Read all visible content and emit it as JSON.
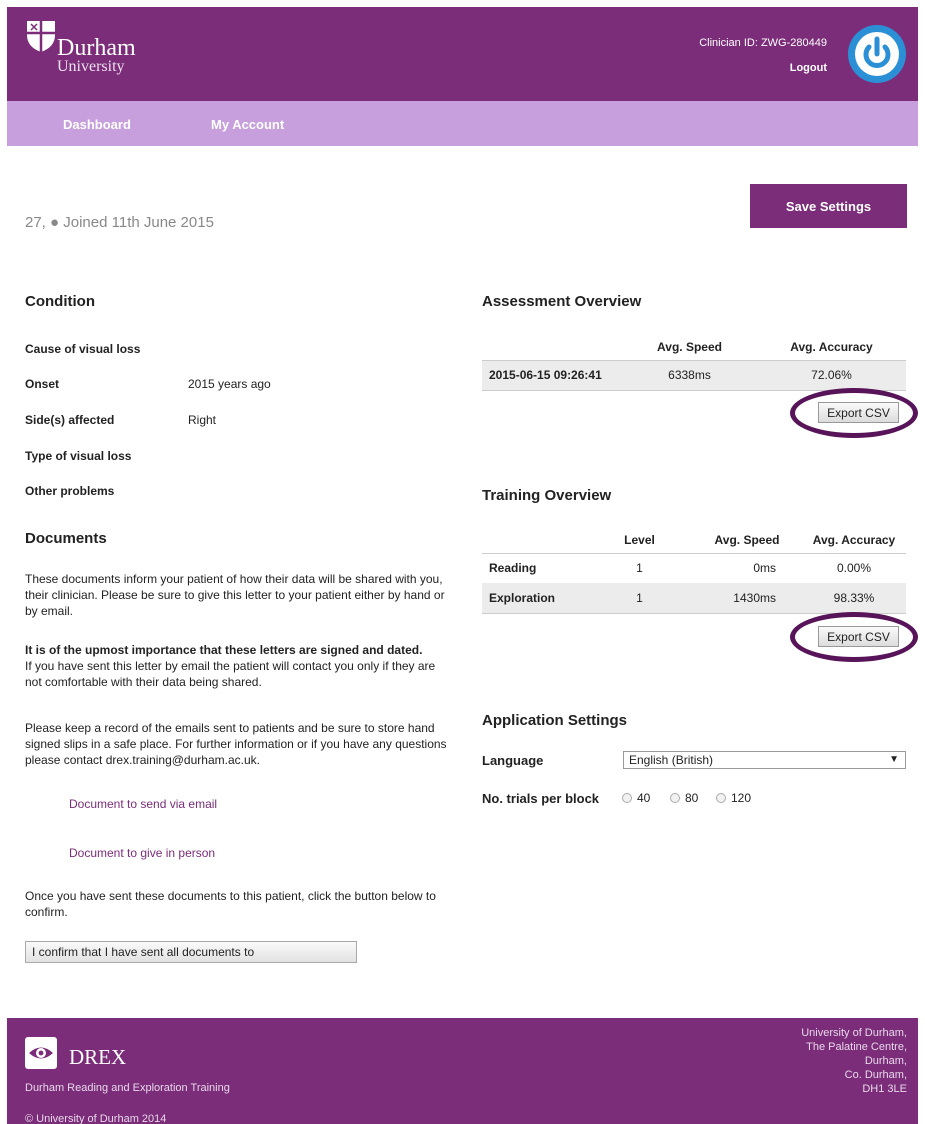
{
  "header": {
    "logo_name": "Durham",
    "logo_sub": "University",
    "clinician_id": "Clinician ID: ZWG-280449",
    "logout": "Logout",
    "power_icon": "power-icon"
  },
  "nav": {
    "dashboard": "Dashboard",
    "my_account": "My Account"
  },
  "patient": {
    "joined": "27, ● Joined 11th June 2015"
  },
  "save_settings": "Save Settings",
  "condition": {
    "title": "Condition",
    "cause_label": "Cause of visual loss",
    "onset_label": "Onset",
    "onset_value": "2015 years ago",
    "side_label": "Side(s) affected",
    "side_value": "Right",
    "type_label": "Type of visual loss",
    "other_label": "Other problems"
  },
  "documents": {
    "title": "Documents",
    "p1": "These documents inform your patient of how their data will be shared with you, their clinician. Please be sure to give this letter to your patient either by hand or by email.",
    "p2_bold": "It is of the upmost importance that these letters are signed and dated.",
    "p2_rest": "If you have sent this letter by email the patient will contact you only if they are not comfortable with their data being shared.",
    "p3": "Please keep a record of the emails sent to patients and be sure to store hand signed slips in a safe place. For further information or if you have any questions please contact drex.training@durham.ac.uk.",
    "link_email": "Document to send via email",
    "link_person": "Document to give in person",
    "p4": "Once you have sent these documents to this patient, click the button below to confirm.",
    "confirm_button": "I confirm that I have sent all documents to"
  },
  "assessment": {
    "title": "Assessment Overview",
    "headers": [
      "",
      "Avg. Speed",
      "Avg. Accuracy"
    ],
    "rows": [
      [
        "2015-06-15 09:26:41",
        "6338ms",
        "72.06%"
      ]
    ],
    "export": "Export CSV"
  },
  "training": {
    "title": "Training Overview",
    "headers": [
      "",
      "Level",
      "Avg. Speed",
      "Avg. Accuracy"
    ],
    "rows": [
      [
        "Reading",
        "1",
        "0ms",
        "0.00%"
      ],
      [
        "Exploration",
        "1",
        "1430ms",
        "98.33%"
      ]
    ],
    "export": "Export CSV"
  },
  "settings": {
    "title": "Application Settings",
    "language_label": "Language",
    "language_value": "English (British)",
    "trials_label": "No. trials per block",
    "trials_options": [
      "40",
      "80",
      "120"
    ]
  },
  "footer": {
    "brand": "DREX",
    "tagline": "Durham Reading and Exploration Training",
    "copyright": "© University of Durham 2014",
    "address": [
      "University of Durham,",
      "The Palatine Centre,",
      "Durham,",
      "Co. Durham,",
      "DH1 3LE"
    ]
  },
  "colors": {
    "brand_purple": "#7b2d7a",
    "nav_lilac": "#c69fdc",
    "highlight_ring": "#581458",
    "power_blue": "#2b8fd6"
  }
}
